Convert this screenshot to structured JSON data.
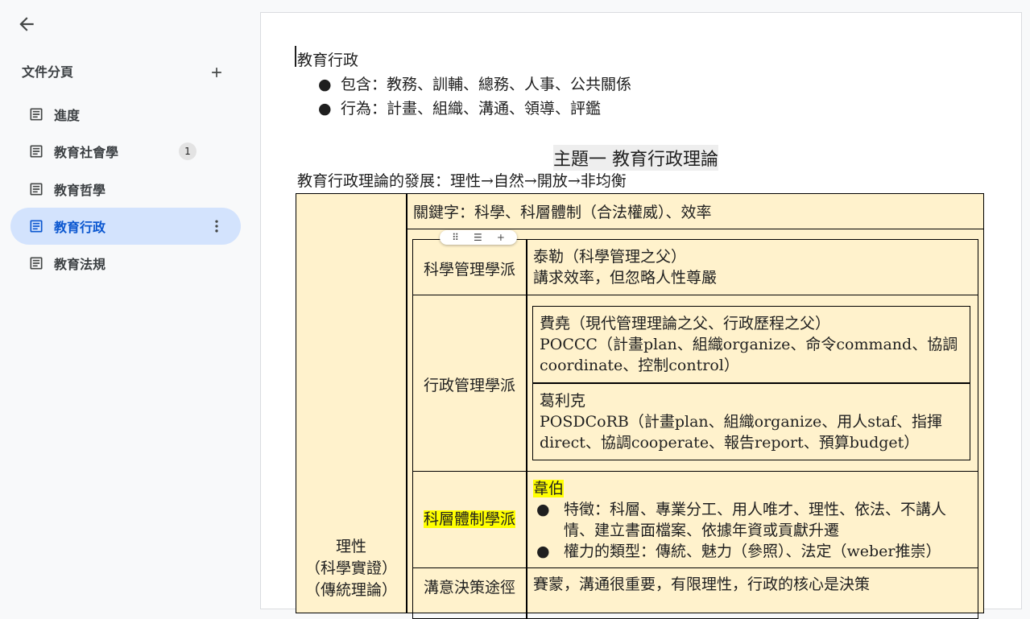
{
  "sidebar": {
    "header": "文件分頁",
    "tabs": [
      {
        "label": "進度",
        "badge": ""
      },
      {
        "label": "教育社會學",
        "badge": "1"
      },
      {
        "label": "教育哲學",
        "badge": ""
      },
      {
        "label": "教育行政",
        "badge": ""
      },
      {
        "label": "教育法規",
        "badge": ""
      }
    ],
    "active_tab": "教育行政"
  },
  "document": {
    "title": "教育行政",
    "bullets": [
      "包含：教務、訓輔、總務、人事、公共關係",
      "行為：計畫、組織、溝通、領導、評鑑"
    ],
    "heading": "主題一 教育行政理論",
    "development": "教育行政理論的發展：理性→自然→開放→非均衡",
    "table": {
      "left_label": [
        "理性",
        "（科學實證）",
        "（傳統理論）"
      ],
      "keyword": "關鍵字：科學、科層體制（合法權威）、效率",
      "rows": [
        {
          "label": "科學管理學派",
          "lines": [
            "泰勒（科學管理之父）",
            "講求效率，但忽略人性尊嚴"
          ]
        },
        {
          "label": "行政管理學派",
          "nested": [
            [
              "費堯（現代管理理論之父、行政歷程之父）",
              "POCCC（計畫plan、組織organize、命令command、協調",
              "coordinate、控制control）"
            ],
            [
              "葛利克",
              "POSDCoRB（計畫plan、組織organize、用人staf、指揮",
              "direct、協調cooperate、報告report、預算budget）"
            ]
          ]
        },
        {
          "label": "科層體制學派",
          "name": "韋伯",
          "items": [
            "特徵：科層、專業分工、用人唯才、理性、依法、不講人",
            "情、建立書面檔案、依據年資或貢獻升遷",
            "權力的類型：傳統、魅力（參照）、法定（weber推崇）"
          ]
        },
        {
          "label": "溝意決策途徑",
          "lines": [
            "賽蒙，溝通很重要，有限理性，行政的核心是決策"
          ]
        }
      ]
    }
  },
  "colors": {
    "active_tab_bg": "#d3e3fd",
    "table_bg": "#fff2cc",
    "highlight": "#ffff00"
  }
}
